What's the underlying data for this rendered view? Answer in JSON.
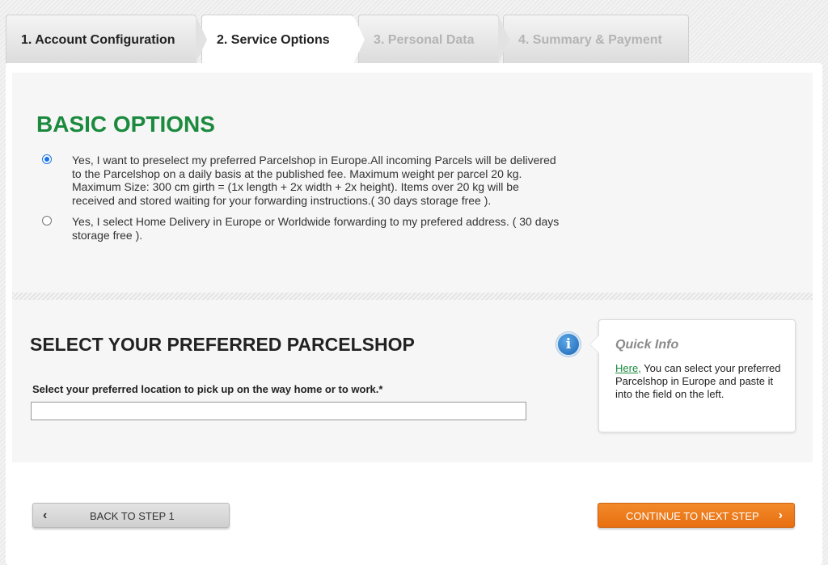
{
  "tabs": [
    {
      "label": "1. Account Configuration",
      "state": "completed"
    },
    {
      "label": "2. Service Options",
      "state": "active"
    },
    {
      "label": "3. Personal Data",
      "state": "disabled"
    },
    {
      "label": "4. Summary & Payment",
      "state": "disabled"
    }
  ],
  "basic_options": {
    "heading": "BASIC OPTIONS",
    "options": [
      {
        "text": "Yes, I want to preselect my preferred Parcelshop in Europe.All incoming Parcels will be delivered to the Parcelshop on a daily basis at the published fee. Maximum weight per parcel 20 kg. Maximum Size: 300 cm girth = (1x length + 2x width + 2x height). Items over 20 kg will be received and stored waiting for your forwarding instructions.( 30 days storage free ).",
        "selected": true
      },
      {
        "text": "Yes, I select Home Delivery in Europe or Worldwide forwarding to my prefered address. ( 30 days storage free ).",
        "selected": false
      }
    ]
  },
  "parcelshop": {
    "heading": "SELECT YOUR PREFERRED PARCELSHOP",
    "field_label": "Select your preferred location to pick up on the way home or to work.*",
    "field_value": "",
    "info_icon": "info-icon"
  },
  "quick_info": {
    "title": "Quick Info",
    "link_text": "Here,",
    "body": " You can select your preferred Parcelshop in Europe and paste it into the field on the left."
  },
  "buttons": {
    "back_label": "BACK TO STEP 1",
    "next_label": "CONTINUE TO NEXT STEP"
  },
  "colors": {
    "accent_green": "#1b8a3e",
    "next_button_orange": "#e8741a",
    "radio_blue": "#1a73e8"
  }
}
